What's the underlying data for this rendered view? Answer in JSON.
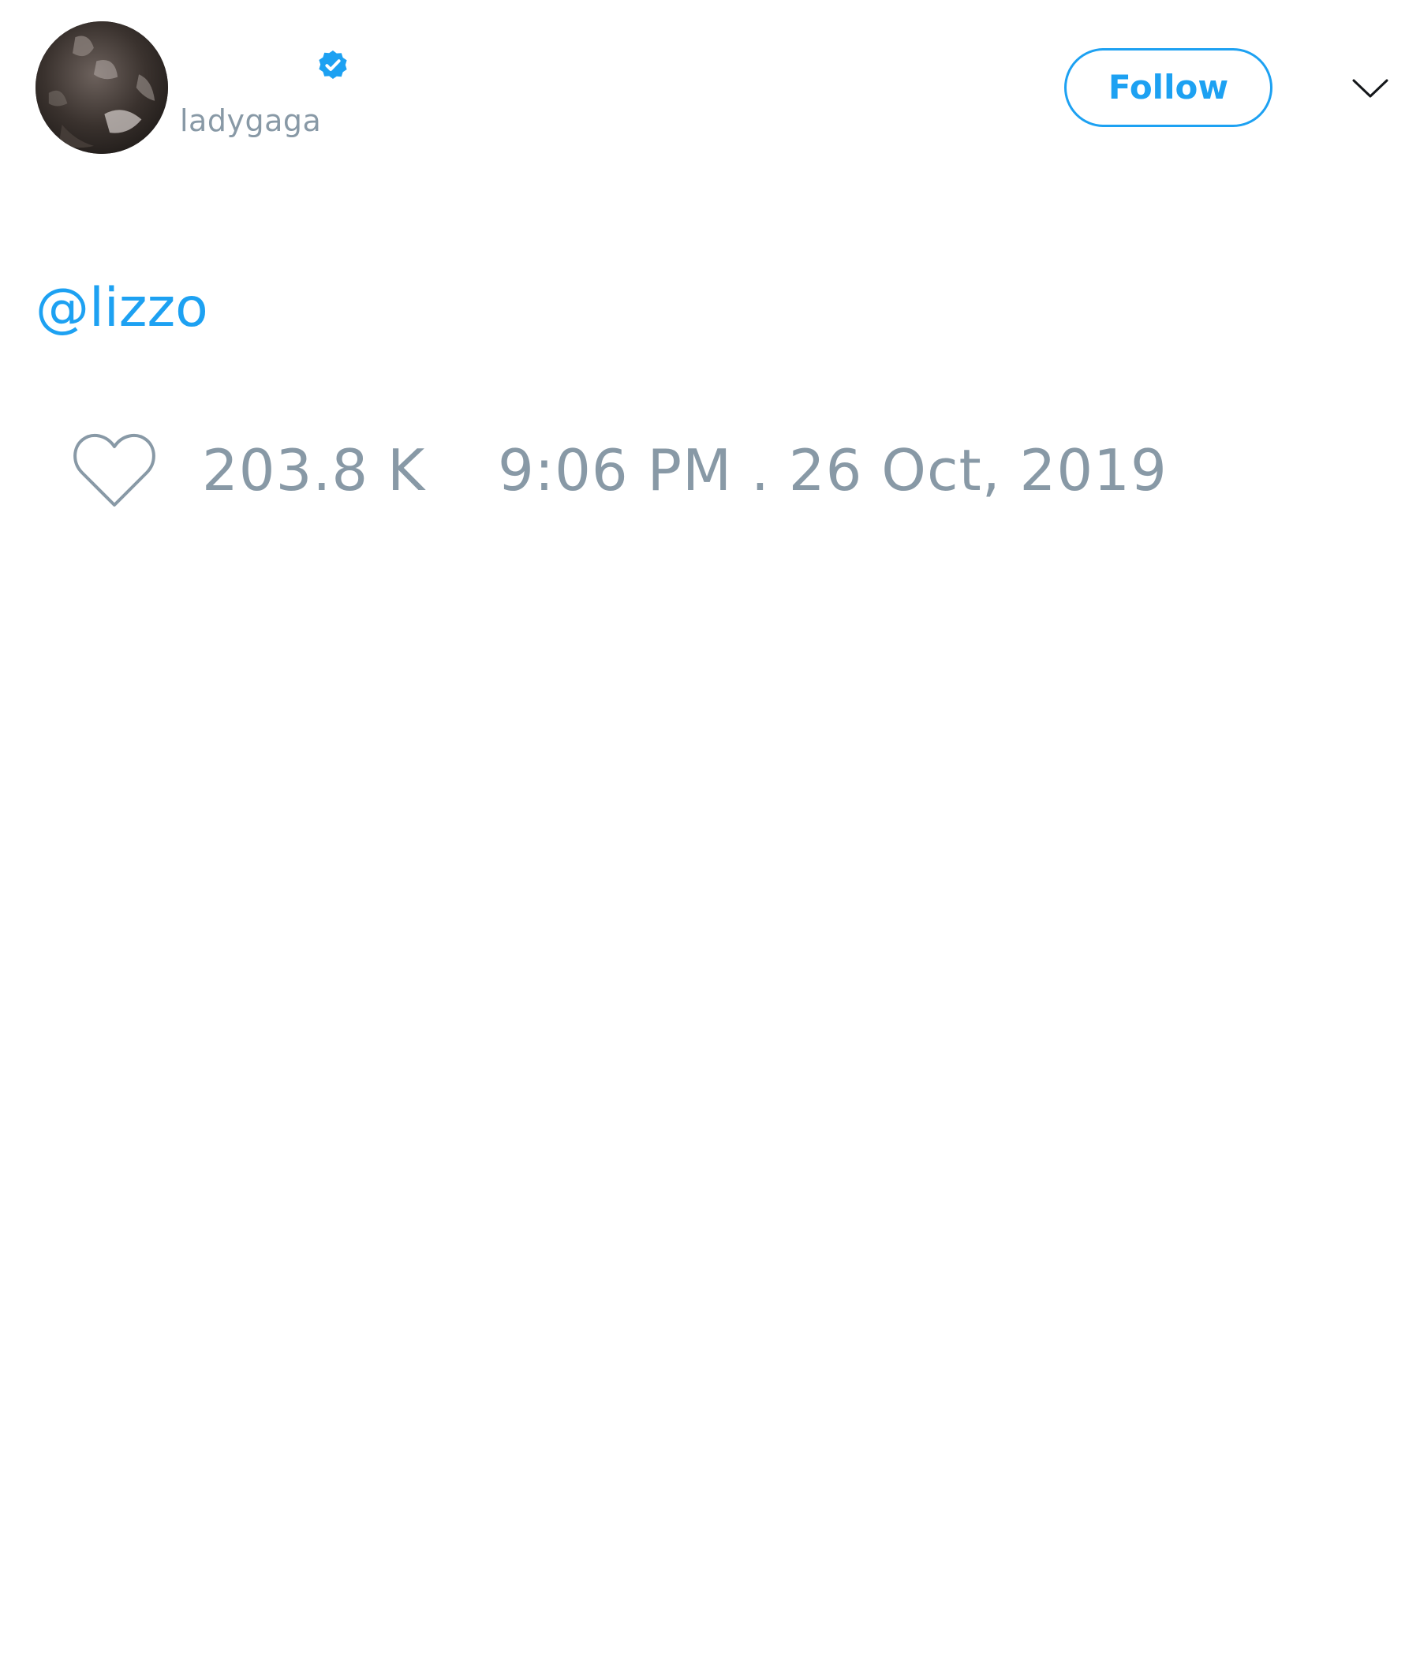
{
  "tweet": {
    "author": {
      "display_name": "",
      "username": "ladygaga",
      "verified": true,
      "avatar_icon": "profile-photo"
    },
    "follow_label": "Follow",
    "menu_icon": "chevron-down-icon",
    "text": "@lizzo",
    "like_icon": "heart-icon",
    "like_count": "203.8 K",
    "timestamp": "9:06 PM . 26 Oct, 2019"
  },
  "colors": {
    "accent": "#1da1f2",
    "muted": "#8899a6",
    "text": "#14171a",
    "background": "#ffffff"
  }
}
